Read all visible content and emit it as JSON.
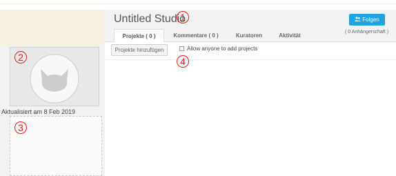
{
  "studio": {
    "title": "Untitled Studio",
    "follow_label": "Folgen",
    "followers_text": "( 0 Anhängerschaft )"
  },
  "tabs": [
    {
      "label": "Projekte ( 0 )",
      "active": true
    },
    {
      "label": "Kommentare ( 0 )",
      "active": false
    },
    {
      "label": "Kuratoren",
      "active": false
    },
    {
      "label": "Aktivität",
      "active": false
    }
  ],
  "projects": {
    "add_button_label": "Projekte hinzufügen",
    "allow_label": "Allow anyone to add projects",
    "allow_checked": false
  },
  "sidebar": {
    "updated_text": "Aktualisiert am 8 Feb 2019",
    "thumbnail_icon": "cat-face-icon"
  },
  "annotations": [
    "1",
    "2",
    "3",
    "4"
  ],
  "colors": {
    "accent": "#1fa4e0",
    "marker": "#e01b1b"
  }
}
